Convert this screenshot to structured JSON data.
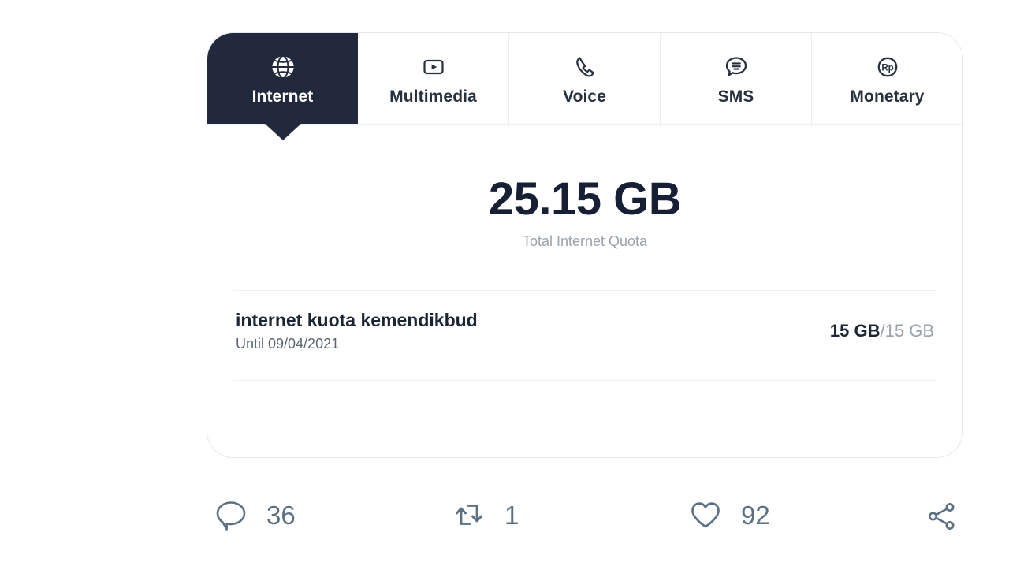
{
  "card": {
    "tabs": [
      {
        "label": "Internet",
        "icon": "globe-icon",
        "active": true
      },
      {
        "label": "Multimedia",
        "icon": "video-play-icon",
        "active": false
      },
      {
        "label": "Voice",
        "icon": "phone-icon",
        "active": false
      },
      {
        "label": "SMS",
        "icon": "chat-bubble-icon",
        "active": false
      },
      {
        "label": "Monetary",
        "icon": "rupiah-circle-icon",
        "active": false
      }
    ],
    "summary": {
      "value": "25.15 GB",
      "caption": "Total Internet Quota"
    },
    "quotas": [
      {
        "name": "internet kuota kemendikbud",
        "expiry": "Until 09/04/2021",
        "used": "15 GB",
        "separator": "/",
        "total": "15 GB"
      }
    ],
    "monetary_icon_text": "Rp"
  },
  "actions": {
    "reply": {
      "icon": "reply-icon",
      "count": "36"
    },
    "repost": {
      "icon": "retweet-icon",
      "count": "1"
    },
    "like": {
      "icon": "heart-icon",
      "count": "92"
    },
    "share": {
      "icon": "share-icon",
      "count": ""
    }
  },
  "colors": {
    "active_tab_bg": "#23293c",
    "text_dark": "#1c2533",
    "text_muted": "#9aa3ab",
    "action_icon": "#5b7083",
    "divider": "#eef1f3",
    "card_border": "#e3e8ec"
  }
}
